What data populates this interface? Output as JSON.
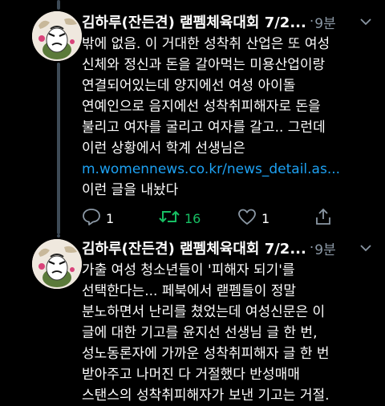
{
  "tweets": [
    {
      "author": "김하루(잔든견) 랟펨체육대회 7/2...",
      "separator": "·",
      "time": "9분",
      "lines": [
        "밖에 없음. 이 거대한 성착취 산업은 또 여성",
        "신체와 정신과 돈을 갈아먹는 미용산업이랑",
        "연결되어있는데 양지에선 여성 아이돌",
        "연예인으로 음지에선 성착취피해자로 돈을",
        "불리고 여자를 굴리고 여자를 갈고.. 그런데",
        "이런 상황에서 학계 선생님은"
      ],
      "link": "m.womennews.co.kr/news_detail.as...",
      "after_link": "이런 글을 내놨다",
      "actions": {
        "reply_count": "1",
        "retweet_count": "16",
        "like_count": "1"
      }
    },
    {
      "author": "김하루(잔든견) 랟펨체육대회 7/2...",
      "separator": "·",
      "time": "9분",
      "lines": [
        "가출 여성 청소년들이 '피해자 되기'를",
        "선택한다는... 페북에서 랟펨들이 정말",
        "분노하면서 난리를 쳤었는데 여성신문은 이",
        "글에 대한 기고를 윤지선 선생님 글 한 번,",
        "성노동론자에 가까운 성착취피해자 글 한 번",
        "받아주고 나머진 다 거절했다 반성매매",
        "스탠스의 성착취피해자가 보낸 기고는 거절."
      ]
    }
  ],
  "icons": {
    "more": "chevron-down-icon",
    "reply": "reply-icon",
    "retweet": "retweet-icon",
    "like": "heart-icon",
    "share": "share-icon"
  },
  "colors": {
    "background": "#000000",
    "text": "#ffffff",
    "muted": "#8b98a5",
    "link": "#1da1f2",
    "retweet_active": "#17bf63",
    "thread_line": "#3d4a56"
  }
}
